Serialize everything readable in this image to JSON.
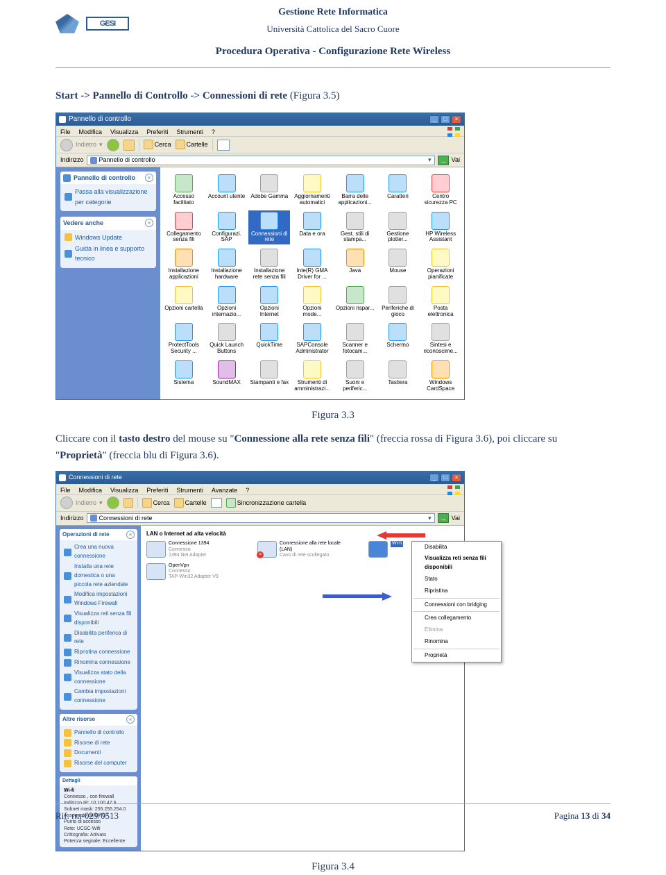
{
  "header": {
    "line1": "Gestione Rete Informatica",
    "line2": "Università Cattolica del Sacro Cuore",
    "line3": "Procedura Operativa - Configurazione Rete Wireless",
    "logo2_text": "GESI"
  },
  "body": {
    "intro_prefix": "Start -> Pannello di Controllo -> Connessioni di rete",
    "intro_suffix": " (Figura 3.5)",
    "caption1": "Figura 3.3",
    "para2_a": "Cliccare con il ",
    "para2_b": "tasto destro",
    "para2_c": " del mouse su \"",
    "para2_d": "Connessione alla rete senza fili",
    "para2_e": "\" (freccia rossa di Figura 3.6), poi cliccare su \"",
    "para2_f": "Proprietà",
    "para2_g": "\" (freccia blu di Figura 3.6).",
    "caption2": "Figura 3.4"
  },
  "shot1": {
    "title": "Pannello di controllo",
    "menus": [
      "File",
      "Modifica",
      "Visualizza",
      "Preferiti",
      "Strumenti",
      "?"
    ],
    "tb_back": "Indietro",
    "tb_search": "Cerca",
    "tb_folders": "Cartelle",
    "addr_label": "Indirizzo",
    "addr_value": "Pannello di controllo",
    "go": "Vai",
    "side1_title": "Pannello di controllo",
    "side1_link": "Passa alla visualizzazione per categorie",
    "side2_title": "Vedere anche",
    "side2_link1": "Windows Update",
    "side2_link2": "Guida in linea e supporto tecnico",
    "icons": [
      {
        "l": "Accesso facilitato",
        "c": "c-green"
      },
      {
        "l": "Account utente",
        "c": "c-blue"
      },
      {
        "l": "Adobe Gamma",
        "c": "c-gray"
      },
      {
        "l": "Aggiornamenti automatici",
        "c": "c-yellow"
      },
      {
        "l": "Barra delle applicazioni...",
        "c": "c-blue"
      },
      {
        "l": "Caratteri",
        "c": "c-blue"
      },
      {
        "l": "Centro sicurezza PC",
        "c": "c-red"
      },
      {
        "l": "Collegamento senza fili",
        "c": "c-red"
      },
      {
        "l": "Configurazi. SAP",
        "c": "c-blue"
      },
      {
        "l": "Connessioni di rete",
        "c": "c-blue",
        "sel": true
      },
      {
        "l": "Data e ora",
        "c": "c-blue"
      },
      {
        "l": "Gest. stili di stampa...",
        "c": "c-gray"
      },
      {
        "l": "Gestione plotter...",
        "c": "c-gray"
      },
      {
        "l": "HP Wireless Assistant",
        "c": "c-blue"
      },
      {
        "l": "Installazione applicazioni",
        "c": "c-orange"
      },
      {
        "l": "Installazione hardware",
        "c": "c-blue"
      },
      {
        "l": "Installazione rete senza fili",
        "c": "c-gray"
      },
      {
        "l": "Inte(R) GMA Driver for ...",
        "c": "c-blue"
      },
      {
        "l": "Java",
        "c": "c-orange"
      },
      {
        "l": "Mouse",
        "c": "c-gray"
      },
      {
        "l": "Operazioni pianificate",
        "c": "c-yellow"
      },
      {
        "l": "Opzioni cartella",
        "c": "c-yellow"
      },
      {
        "l": "Opzioni internazio...",
        "c": "c-blue"
      },
      {
        "l": "Opzioni Internet",
        "c": "c-blue"
      },
      {
        "l": "Opzioni mode...",
        "c": "c-yellow"
      },
      {
        "l": "Opzioni rispar...",
        "c": "c-green"
      },
      {
        "l": "Periferiche di gioco",
        "c": "c-gray"
      },
      {
        "l": "Posta elettronica",
        "c": "c-yellow"
      },
      {
        "l": "ProtectTools Security ...",
        "c": "c-blue"
      },
      {
        "l": "Quick Launch Buttons",
        "c": "c-gray"
      },
      {
        "l": "QuickTime",
        "c": "c-blue"
      },
      {
        "l": "SAPConsole Administrator",
        "c": "c-blue"
      },
      {
        "l": "Scanner e fotocam...",
        "c": "c-gray"
      },
      {
        "l": "Schermo",
        "c": "c-blue"
      },
      {
        "l": "Sintesi e riconoscime...",
        "c": "c-gray"
      },
      {
        "l": "Sistema",
        "c": "c-blue"
      },
      {
        "l": "SoundMAX",
        "c": "c-purple"
      },
      {
        "l": "Stampanti e fax",
        "c": "c-gray"
      },
      {
        "l": "Strumenti di amministrazi...",
        "c": "c-yellow"
      },
      {
        "l": "Suoni e periferic...",
        "c": "c-gray"
      },
      {
        "l": "Tastiera",
        "c": "c-gray"
      },
      {
        "l": "Windows CardSpace",
        "c": "c-orange"
      }
    ]
  },
  "shot2": {
    "title": "Connessioni di rete",
    "menus": [
      "File",
      "Modifica",
      "Visualizza",
      "Preferiti",
      "Strumenti",
      "Avanzate",
      "?"
    ],
    "tb_back": "Indietro",
    "tb_search": "Cerca",
    "tb_folders": "Cartelle",
    "tb_sync": "Sincronizzazione cartella",
    "addr_label": "Indirizzo",
    "addr_value": "Connessioni di rete",
    "go": "Vai",
    "cat_header": "LAN o Internet ad alta velocità",
    "items": [
      {
        "t1": "Connessione 1394",
        "t2": "Connesso",
        "t3": "1394 Net Adapter"
      },
      {
        "t1": "Connessione alla rete locale (LAN)",
        "t2": "Cavo di rete scollegato",
        "t3": "",
        "x": true
      },
      {
        "t1": "Wi-fi",
        "t2": "",
        "t3": "",
        "sel": true
      }
    ],
    "items2": [
      {
        "t1": "OpenVpn",
        "t2": "Connesso",
        "t3": "TAP-Win32 Adapter V9"
      }
    ],
    "ctx": [
      {
        "l": "Disabilita"
      },
      {
        "l": "Visualizza reti senza fili disponibili",
        "bold": true
      },
      {
        "l": "Stato"
      },
      {
        "l": "Ripristina"
      },
      {
        "sep": true
      },
      {
        "l": "Connessioni con bridging"
      },
      {
        "sep": true
      },
      {
        "l": "Crea collegamento"
      },
      {
        "l": "Elimina",
        "gray": true
      },
      {
        "l": "Rinomina"
      },
      {
        "sep": true
      },
      {
        "l": "Proprietà"
      }
    ],
    "side1_title": "Operazioni di rete",
    "side1_links": [
      "Crea una nuova connessione",
      "Installa una rete domestica o una piccola rete aziendale",
      "Modifica impostazioni Windows Firewall",
      "Visualizza reti senza fili disponibili",
      "Disabilita periferica di rete",
      "Ripristina connessione",
      "Rinomina connessione",
      "Visualizza stato della connessione",
      "Cambia impostazioni connessione"
    ],
    "side2_title": "Altre risorse",
    "side2_links": [
      "Pannello di controllo",
      "Risorse di rete",
      "Documenti",
      "Risorse del computer"
    ],
    "side3_title": "Dettagli",
    "detail_name": "Wi-fi",
    "detail_lines": [
      "Connesso , con firewall",
      "Indirizzo IP: 10.100.47.6",
      "Subnet mask: 255.255.254.0",
      "Assegnato da DHCP",
      "Punto di accesso",
      "Rete: UCSC-Wifi",
      "Crittografia: Attivato",
      "Potenza segnale: Eccellente"
    ]
  },
  "footer": {
    "left": "Rif. rm-029/0513",
    "right_a": "Pagina ",
    "right_b": "13",
    "right_c": " di ",
    "right_d": "34"
  }
}
